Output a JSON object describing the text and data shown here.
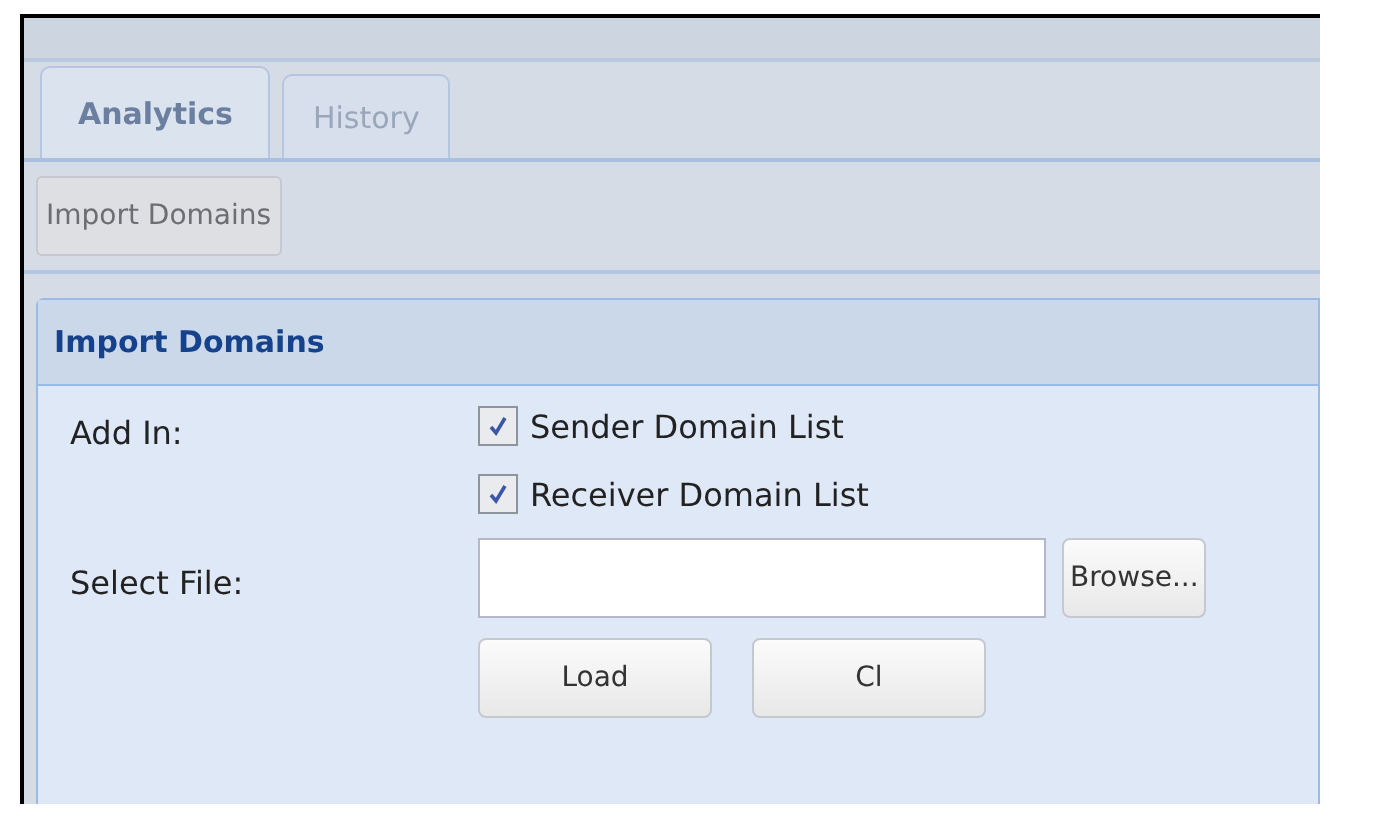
{
  "tabs": [
    {
      "label": "Analytics",
      "selected": true
    },
    {
      "label": "History",
      "selected": false
    }
  ],
  "toolbar": {
    "buttons": [
      "Import Domains"
    ]
  },
  "panel": {
    "title": "Import Domains",
    "add_in_label": "Add In:",
    "options": [
      {
        "label": "Sender Domain List",
        "checked": true
      },
      {
        "label": "Receiver Domain List",
        "checked": true
      }
    ],
    "file_label": "Select File:",
    "browse_button": "Browse...",
    "actions": [
      "Load",
      "Cl"
    ]
  }
}
